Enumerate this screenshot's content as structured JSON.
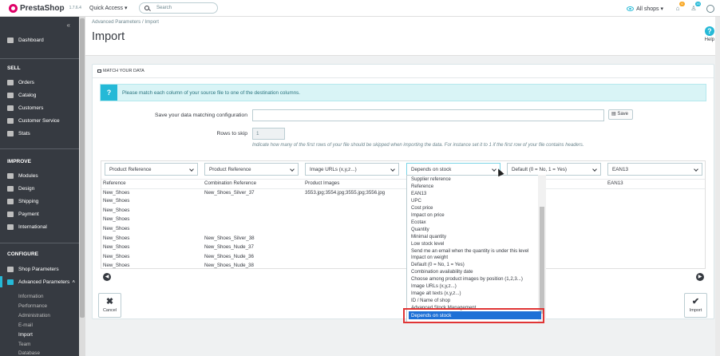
{
  "topbar": {
    "brand": "PrestaShop",
    "version": "1.7.6.4",
    "quick_access": "Quick Access ▾",
    "search_placeholder": "Search",
    "shops": "All shops ▾",
    "badge_orders": "6",
    "badge_customers": "16"
  },
  "sidebar": {
    "dashboard": "Dashboard",
    "sections": [
      "SELL",
      "IMPROVE",
      "CONFIGURE"
    ],
    "sell": [
      "Orders",
      "Catalog",
      "Customers",
      "Customer Service",
      "Stats"
    ],
    "improve": [
      "Modules",
      "Design",
      "Shipping",
      "Payment",
      "International"
    ],
    "configure": [
      "Shop Parameters",
      "Advanced Parameters"
    ],
    "sub": [
      "Information",
      "Performance",
      "Administration",
      "E-mail",
      "Import",
      "Team",
      "Database"
    ]
  },
  "header": {
    "breadcrumb": "Advanced Parameters  /  Import",
    "title": "Import",
    "help": "Help"
  },
  "panel": {
    "heading": "MATCH YOUR DATA",
    "info": "Please match each column of your source file to one of the destination columns.",
    "save_config_label": "Save your data matching configuration",
    "save_button": "Save",
    "rows_skip_label": "Rows to skip",
    "rows_skip_value": "1",
    "hint": "Indicate how many of the first rows of your file should be skipped when importing the data. For instance set it to 1 if the first row of your file contains headers."
  },
  "selects": [
    "Product Reference",
    "Product Reference",
    "Image URLs (x,y,z...)",
    "Depends on stock",
    "Default (0 = No, 1 = Yes)",
    "EAN13"
  ],
  "table": {
    "col1": [
      "Reference",
      "New_Shoes",
      "New_Shoes",
      "New_Shoes",
      "New_Shoes",
      "New_Shoes",
      "New_Shoes",
      "New_Shoes",
      "New_Shoes",
      "New_Shoes"
    ],
    "col2": [
      "Combination Reference",
      "New_Shoes_Silver_37",
      "",
      "",
      "",
      "",
      "New_Shoes_Silver_38",
      "New_Shoes_Nude_37",
      "New_Shoes_Nude_36",
      "New_Shoes_Nude_38"
    ],
    "col3": [
      "Product Images",
      "3553.jpg;3554.jpg;3555.jpg;3556.jpg"
    ],
    "col6": [
      "EAN13"
    ]
  },
  "dropdown": {
    "items": [
      "Supplier reference",
      "Reference",
      "EAN13",
      "UPC",
      "Cost price",
      "Impact on price",
      "Ecotax",
      "Quantity",
      "Minimal quantity",
      "Low stock level",
      "Send me an email when the quantity is under this level",
      "Impact on weight",
      "Default (0 = No, 1 = Yes)",
      "Combination availability date",
      "Choose among product images by position (1,2,3...)",
      "Image URLs (x,y,z...)",
      "Image alt texts (x,y,z...)",
      "ID / Name of shop",
      "Advanced Stock Management"
    ],
    "selected": "Depends on stock"
  },
  "actions": {
    "cancel": "Cancel",
    "import": "Import"
  },
  "colors": {
    "accent": "#25b9d7",
    "sidebar": "#363a41",
    "highlight": "#1e70d6",
    "callout": "#e03535"
  }
}
